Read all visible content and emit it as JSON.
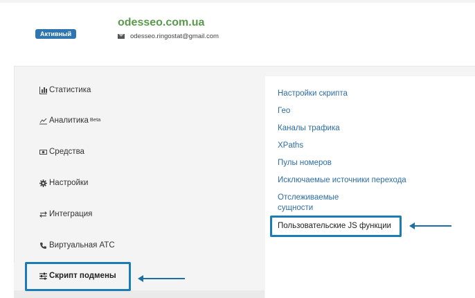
{
  "header": {
    "status_badge": "Активный",
    "site_name": "odesseo.com.ua",
    "email": "odesseo.ringostat@gmail.com"
  },
  "sidebar": {
    "items": [
      {
        "label": "Статистика",
        "icon": "bar-chart-icon"
      },
      {
        "label": "Аналитика",
        "sup": "Beta",
        "icon": "line-chart-icon"
      },
      {
        "label": "Средства",
        "icon": "money-icon"
      },
      {
        "label": "Настройки",
        "icon": "gear-icon"
      },
      {
        "label": "Интеграция",
        "icon": "swap-arrows-icon"
      },
      {
        "label": "Виртуальная АТС",
        "icon": "phone-icon"
      },
      {
        "label": "Скрипт подмены",
        "icon": "sliders-icon",
        "active": true
      }
    ]
  },
  "content": {
    "links": [
      "Настройки скрипта",
      "Гео",
      "Каналы трафика",
      "XPaths",
      "Пулы номеров",
      "Исключаемые источники перехода",
      "Отслеживаемые сущности",
      "Пользовательские JS функции"
    ]
  },
  "colors": {
    "accent": "#1a7bb5",
    "link": "#2e6da4",
    "site_name": "#5a9a4c",
    "badge": "#2f76b0"
  }
}
